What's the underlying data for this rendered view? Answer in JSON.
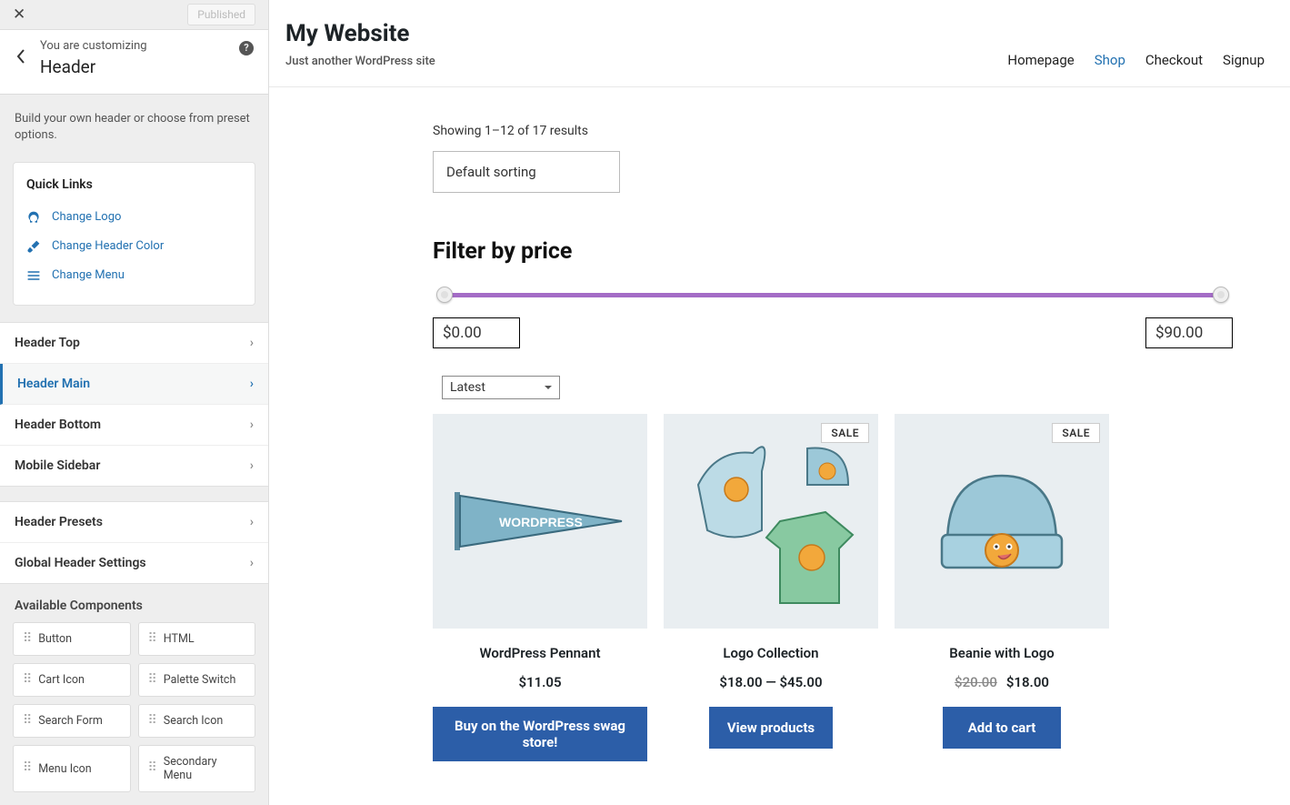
{
  "sidebar": {
    "published_label": "Published",
    "breadcrumb": "You are customizing",
    "panel_title": "Header",
    "description": "Build your own header or choose from preset options.",
    "quick_links": {
      "title": "Quick Links",
      "items": [
        "Change Logo",
        "Change Header Color",
        "Change Menu"
      ]
    },
    "sections_primary": [
      {
        "label": "Header Top",
        "active": false
      },
      {
        "label": "Header Main",
        "active": true
      },
      {
        "label": "Header Bottom",
        "active": false
      },
      {
        "label": "Mobile Sidebar",
        "active": false
      }
    ],
    "sections_secondary": [
      {
        "label": "Header Presets"
      },
      {
        "label": "Global Header Settings"
      }
    ],
    "available_components_title": "Available Components",
    "components": [
      "Button",
      "HTML",
      "Cart Icon",
      "Palette Switch",
      "Search Form",
      "Search Icon",
      "Menu Icon",
      "Secondary Menu"
    ]
  },
  "site": {
    "title": "My Website",
    "tagline": "Just another WordPress site",
    "menu": [
      {
        "label": "Homepage",
        "active": false
      },
      {
        "label": "Shop",
        "active": true
      },
      {
        "label": "Checkout",
        "active": false
      },
      {
        "label": "Signup",
        "active": false
      }
    ]
  },
  "shop": {
    "results_text": "Showing 1–12 of 17 results",
    "sort_value": "Default sorting",
    "filter_title": "Filter by price",
    "range_min": "$0.00",
    "range_max": "$90.00",
    "mini_sort": "Latest",
    "sale_label": "SALE",
    "products": [
      {
        "name": "WordPress Pennant",
        "price_html": "$11.05",
        "btn": "Buy on the WordPress swag store!",
        "sale": false
      },
      {
        "name": "Logo Collection",
        "price_html": "$18.00 — $45.00",
        "btn": "View products",
        "sale": true
      },
      {
        "name": "Beanie with Logo",
        "price_html": "$18.00",
        "old_price": "$20.00",
        "btn": "Add to cart",
        "sale": true
      }
    ]
  }
}
